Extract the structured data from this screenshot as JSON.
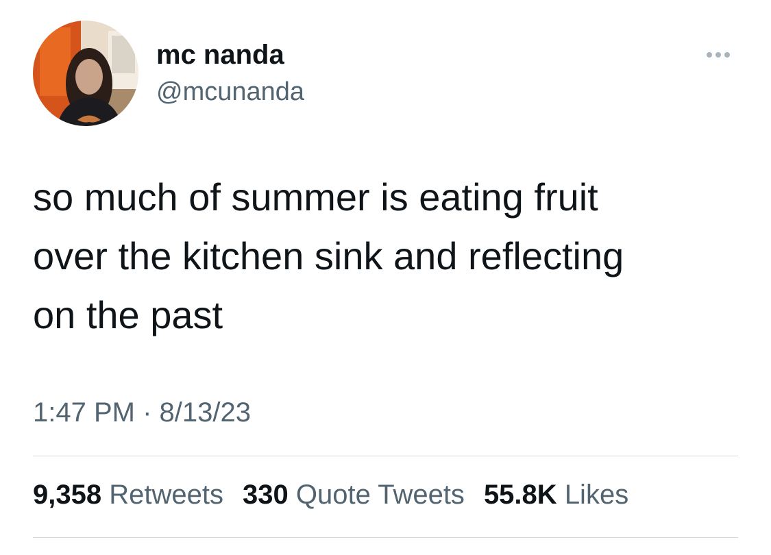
{
  "author": {
    "display_name": "mc nanda",
    "handle": "@mcunanda",
    "avatar_icon": "profile-photo"
  },
  "more_icon": "more-horizontal-icon",
  "tweet": {
    "text": "so much of summer is eating fruit\nover the kitchen sink and reflecting\non the past",
    "time": "1:47 PM",
    "separator": "·",
    "date": "8/13/23"
  },
  "stats": {
    "retweets": {
      "count": "9,358",
      "label": "Retweets"
    },
    "quote_tweets": {
      "count": "330",
      "label": "Quote Tweets"
    },
    "likes": {
      "count": "55.8K",
      "label": "Likes"
    }
  },
  "colors": {
    "primary_text": "#0f1419",
    "secondary_text": "#536471",
    "divider": "#cfd9de",
    "background": "#ffffff"
  }
}
